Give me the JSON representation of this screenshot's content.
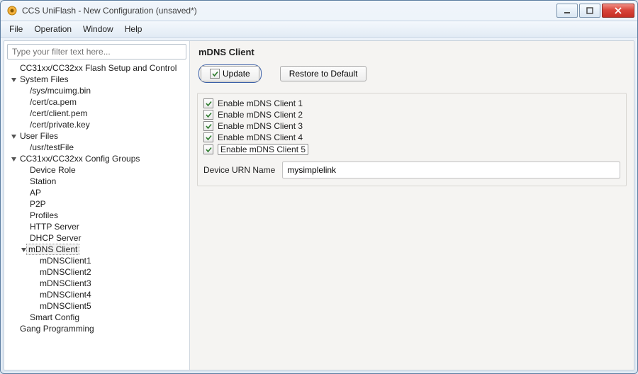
{
  "window": {
    "title": "CCS UniFlash - New Configuration (unsaved*)"
  },
  "menu": {
    "file": "File",
    "operation": "Operation",
    "window": "Window",
    "help": "Help"
  },
  "filter": {
    "placeholder": "Type your filter text here..."
  },
  "tree": {
    "flash_setup": "CC31xx/CC32xx Flash Setup and Control",
    "system_files": "System Files",
    "sf_mcuimg": "/sys/mcuimg.bin",
    "sf_ca": "/cert/ca.pem",
    "sf_client": "/cert/client.pem",
    "sf_private": "/cert/private.key",
    "user_files": "User Files",
    "uf_test": "/usr/testFile",
    "config_groups": "CC31xx/CC32xx Config Groups",
    "cg_device_role": "Device Role",
    "cg_station": "Station",
    "cg_ap": "AP",
    "cg_p2p": "P2P",
    "cg_profiles": "Profiles",
    "cg_http": "HTTP Server",
    "cg_dhcp": "DHCP Server",
    "cg_mdns": "mDNS Client",
    "cg_mdns1": "mDNSClient1",
    "cg_mdns2": "mDNSClient2",
    "cg_mdns3": "mDNSClient3",
    "cg_mdns4": "mDNSClient4",
    "cg_mdns5": "mDNSClient5",
    "cg_smart": "Smart Config",
    "gang": "Gang Programming"
  },
  "panel": {
    "title": "mDNS Client",
    "update": "Update",
    "restore": "Restore to Default",
    "chk1": "Enable mDNS Client 1",
    "chk2": "Enable mDNS Client 2",
    "chk3": "Enable mDNS Client 3",
    "chk4": "Enable mDNS Client 4",
    "chk5": "Enable mDNS Client 5",
    "urn_label": "Device URN Name",
    "urn_value": "mysimplelink"
  }
}
